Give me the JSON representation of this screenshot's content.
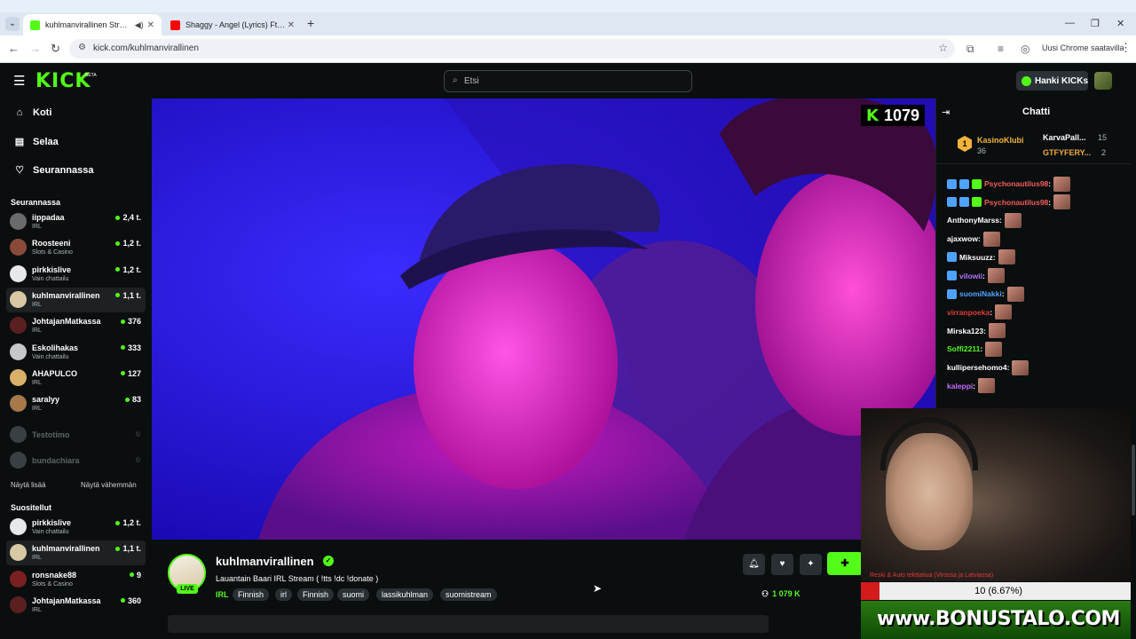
{
  "browser": {
    "tabs": [
      {
        "title": "kuhlmanvirallinen Stream -",
        "audio_icon": "speaker-icon",
        "favicon_color": "#53fc18"
      },
      {
        "title": "Shaggy - Angel (Lyrics) Ft. Rayv",
        "favicon_color": "#ff0000"
      }
    ],
    "url": "kick.com/kuhlmanvirallinen",
    "update_label": "Uusi Chrome saatavilla"
  },
  "header": {
    "logo": "KICK",
    "logo_tag": "BETA",
    "search_placeholder": "Etsi",
    "kicks_button": "Hanki KICKs"
  },
  "sidebar": {
    "nav": [
      {
        "label": "Koti",
        "icon": "home-icon"
      },
      {
        "label": "Selaa",
        "icon": "browse-icon"
      },
      {
        "label": "Seurannassa",
        "icon": "heart-icon"
      }
    ],
    "following_heading": "Seurannassa",
    "following": [
      {
        "name": "iippadaa",
        "category": "IRL",
        "viewers": "2,4 t.",
        "avatar": "#6b6b6b"
      },
      {
        "name": "Roosteeni",
        "category": "Slots & Casino",
        "viewers": "1,2 t.",
        "avatar": "#8a4a3a"
      },
      {
        "name": "pirkkislive",
        "category": "Vain chattailu",
        "viewers": "1,2 t.",
        "avatar": "#e8e8e8"
      },
      {
        "name": "kuhlmanvirallinen",
        "category": "IRL",
        "viewers": "1,1 t.",
        "avatar": "#d9c8a4",
        "active": true
      },
      {
        "name": "JohtajanMatkassa",
        "category": "IRL",
        "viewers": "376",
        "avatar": "#5a2020"
      },
      {
        "name": "Eskolihakas",
        "category": "Vain chattailu",
        "viewers": "333",
        "avatar": "#c8c8c8"
      },
      {
        "name": "AHAPULCO",
        "category": "IRL",
        "viewers": "127",
        "avatar": "#d9b06a"
      },
      {
        "name": "saralyy",
        "category": "IRL",
        "viewers": "83",
        "avatar": "#a6784a"
      }
    ],
    "offline": [
      {
        "name": "Testotimo"
      },
      {
        "name": "bundachiara"
      }
    ],
    "show_more": "Näytä lisää",
    "show_less": "Näytä vähemmän",
    "recommended_heading": "Suositellut",
    "recommended": [
      {
        "name": "pirkkislive",
        "category": "Vain chattailu",
        "viewers": "1,2 t.",
        "avatar": "#e8e8e8"
      },
      {
        "name": "kuhlmanvirallinen",
        "category": "IRL",
        "viewers": "1,1 t.",
        "avatar": "#d9c8a4",
        "active": true
      },
      {
        "name": "ronsnake88",
        "category": "Slots & Casino",
        "viewers": "9",
        "avatar": "#7a2020"
      },
      {
        "name": "JohtajanMatkassa",
        "category": "IRL",
        "viewers": "360",
        "avatar": "#5a2020"
      }
    ]
  },
  "player": {
    "viewer_count": "1079"
  },
  "stream": {
    "live_label": "LIVE",
    "streamer": "kuhlmanvirallinen",
    "title": "Lauantain Baari IRL Stream ( !tts !dc !donate )",
    "category": "IRL",
    "tags": [
      "Finnish",
      "irl",
      "Finnish",
      "suomi",
      "lassikuhlman",
      "suomistream"
    ],
    "viewers": "1 079",
    "viewers_suffix": "K"
  },
  "chat": {
    "title": "Chatti",
    "leaderboard": {
      "first": {
        "rank": "1",
        "name": "KasinoKlubi",
        "count": "36"
      },
      "second": {
        "name": "KarvaPall...",
        "count": "15"
      },
      "third": {
        "name": "GTFYFERY...",
        "count": "2"
      }
    },
    "messages": [
      {
        "user": "Psychonautilus98",
        "color": "#f65c5c",
        "badges": 3
      },
      {
        "user": "Psychonautilus98",
        "color": "#f65c5c",
        "badges": 3
      },
      {
        "user": "AnthonyMarss",
        "color": "#ffffff",
        "badges": 0
      },
      {
        "user": "ajaxwow",
        "color": "#ffffff",
        "badges": 0
      },
      {
        "user": "Miksuuzz",
        "color": "#ffffff",
        "badges": 1
      },
      {
        "user": "vilowii",
        "color": "#b675ff",
        "badges": 1
      },
      {
        "user": "suomiNakki",
        "color": "#4da3ff",
        "badges": 1
      },
      {
        "user": "virranpoeka",
        "color": "#e33b3b",
        "badges": 0
      },
      {
        "user": "Mirska123",
        "color": "#ffffff",
        "badges": 0
      },
      {
        "user": "Soffi2211",
        "color": "#53fc18",
        "badges": 0
      },
      {
        "user": "kullipersehomo4",
        "color": "#ffffff",
        "badges": 0
      },
      {
        "user": "kaleppi",
        "color": "#c46bff",
        "badges": 0
      }
    ]
  },
  "overlay": {
    "promo": "Reski & Auto tekttatiua (Virossa ja Latviassa)",
    "goal_text": "10 (6.67%)",
    "goal_percent": 6.67,
    "bonus_text": "www.BONUSTALO.COM"
  },
  "colors": {
    "accent": "#53fc18",
    "background": "#0b0e0f"
  }
}
